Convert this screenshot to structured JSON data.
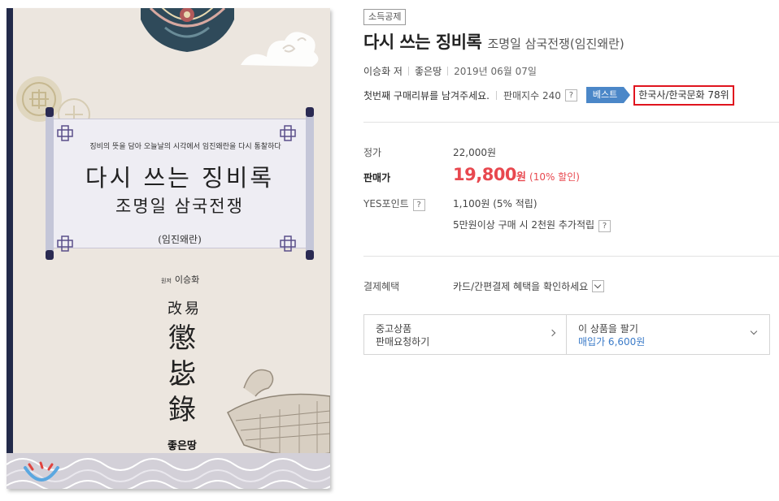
{
  "cover": {
    "subtitle": "징비의 뜻을 담아 오늘날의 시각에서 임진왜란을 다시 통찰하다",
    "title": "다시 쓰는 징비록",
    "title2": "조명일 삼국전쟁",
    "title3": "(임진왜란)",
    "author_prefix": "원저",
    "author": "이승화",
    "hanja_small": "改易",
    "hanja_large": [
      "懲",
      "毖",
      "錄"
    ],
    "publisher": "좋은땅"
  },
  "product": {
    "badge": "소득공제",
    "title": "다시 쓰는 징비록",
    "subtitle": "조명일 삼국전쟁(임진왜란)",
    "author": "이승화 저",
    "publisher": "좋은땅",
    "date": "2019년 06월 07일",
    "review_prompt": "첫번째 구매리뷰를 남겨주세요.",
    "sales_index": "판매지수 240",
    "help_mark": "?",
    "best_tag": "베스트",
    "rank": "한국사/한국문화 78위"
  },
  "pricing": {
    "list_label": "정가",
    "list_price": "22,000원",
    "sale_label": "판매가",
    "sale_price": "19,800",
    "sale_unit": "원",
    "discount": "(10% 할인)",
    "points_label": "YES포인트",
    "points_value": "1,100원 (5% 적립)",
    "points_extra": "5만원이상 구매 시 2천원 추가적립",
    "benefit_label": "결제혜택",
    "benefit_value": "카드/간편결제 혜택을 확인하세요"
  },
  "used": {
    "left_title": "중고상품",
    "left_sub": "판매요청하기",
    "right_title": "이 상품을 팔기",
    "right_sub": "매입가 6,600원"
  },
  "colors": {
    "price_red": "#e8484f",
    "best_blue": "#4b87c8",
    "highlight_red": "#e0141e",
    "link_blue": "#3b7bc8"
  }
}
